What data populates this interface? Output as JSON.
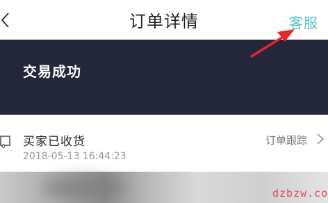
{
  "navbar": {
    "back_icon": "chevron-left-icon",
    "title": "订单详情",
    "service_label": "客服",
    "service_color": "#4fc1bd"
  },
  "annotation": {
    "arrow_color": "#e8262a"
  },
  "banner": {
    "status_text": "交易成功",
    "background": "#24263a"
  },
  "shipping": {
    "icon": "truck-icon",
    "status": "买家已收货",
    "timestamp": "2018-05-13 16:44:23",
    "track_label": "订单跟踪",
    "chevron_icon": "chevron-right-icon"
  },
  "watermark": {
    "text": "dzbzw.com",
    "color": "#e0475f"
  }
}
